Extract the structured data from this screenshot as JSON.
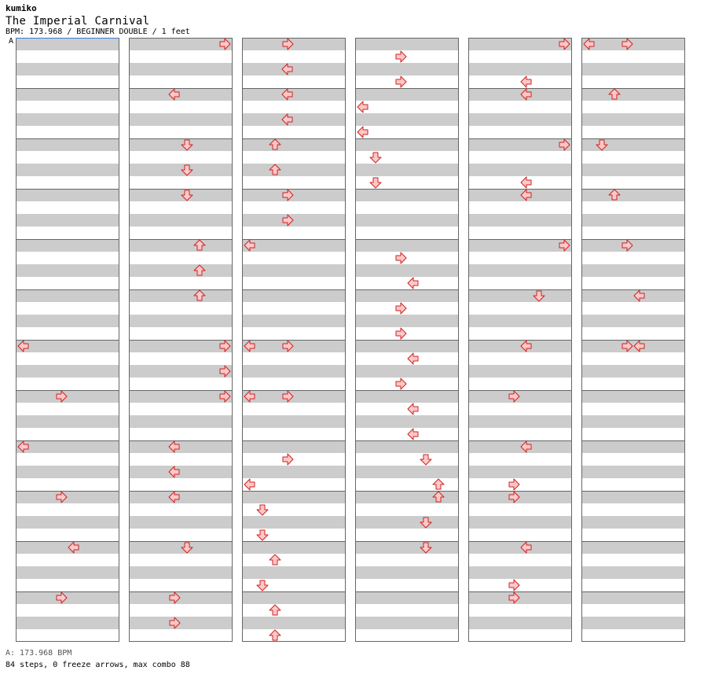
{
  "header": {
    "author": "kumiko",
    "title": "The Imperial Carnival",
    "info": "BPM: 173.968 / BEGINNER DOUBLE / 1 feet"
  },
  "marker": "A",
  "footer": {
    "bpm_line": "A: 173.968 BPM",
    "stats_line": "84 steps, 0 freeze arrows, max combo 88"
  },
  "colors": {
    "band_gray": "#cccccc",
    "border": "#666666",
    "arrow_fill": "#ffc8c8",
    "arrow_stroke": "#cc2222",
    "bpm_line": "#3a7ad8"
  },
  "chart_data": {
    "type": "step-chart",
    "columns": 6,
    "measures_per_column": 12,
    "lane_order": [
      "left",
      "down",
      "up",
      "right",
      "left",
      "down",
      "up",
      "right"
    ],
    "notes": [
      {
        "col": 1,
        "row": 0,
        "lane": 7,
        "dir": "right"
      },
      {
        "col": 1,
        "row": 4,
        "lane": 3,
        "dir": "left"
      },
      {
        "col": 1,
        "row": 8,
        "lane": 4,
        "dir": "down"
      },
      {
        "col": 1,
        "row": 10,
        "lane": 4,
        "dir": "down"
      },
      {
        "col": 1,
        "row": 12,
        "lane": 4,
        "dir": "down"
      },
      {
        "col": 1,
        "row": 16,
        "lane": 5,
        "dir": "up"
      },
      {
        "col": 1,
        "row": 18,
        "lane": 5,
        "dir": "up"
      },
      {
        "col": 1,
        "row": 20,
        "lane": 5,
        "dir": "up"
      },
      {
        "col": 1,
        "row": 24,
        "lane": 7,
        "dir": "right"
      },
      {
        "col": 1,
        "row": 26,
        "lane": 7,
        "dir": "right"
      },
      {
        "col": 1,
        "row": 28,
        "lane": 7,
        "dir": "right"
      },
      {
        "col": 1,
        "row": 32,
        "lane": 3,
        "dir": "left"
      },
      {
        "col": 1,
        "row": 34,
        "lane": 3,
        "dir": "left"
      },
      {
        "col": 1,
        "row": 36,
        "lane": 3,
        "dir": "left"
      },
      {
        "col": 1,
        "row": 40,
        "lane": 4,
        "dir": "down"
      },
      {
        "col": 1,
        "row": 44,
        "lane": 3,
        "dir": "right"
      },
      {
        "col": 1,
        "row": 46,
        "lane": 3,
        "dir": "right"
      },
      {
        "col": 2,
        "row": 0,
        "lane": 3,
        "dir": "right"
      },
      {
        "col": 2,
        "row": 2,
        "lane": 3,
        "dir": "left"
      },
      {
        "col": 2,
        "row": 4,
        "lane": 3,
        "dir": "left"
      },
      {
        "col": 2,
        "row": 6,
        "lane": 3,
        "dir": "left"
      },
      {
        "col": 2,
        "row": 8,
        "lane": 2,
        "dir": "up"
      },
      {
        "col": 2,
        "row": 10,
        "lane": 2,
        "dir": "up"
      },
      {
        "col": 2,
        "row": 12,
        "lane": 3,
        "dir": "right"
      },
      {
        "col": 2,
        "row": 14,
        "lane": 3,
        "dir": "right"
      },
      {
        "col": 2,
        "row": 16,
        "lane": 0,
        "dir": "left"
      },
      {
        "col": 2,
        "row": 24,
        "lane": 0,
        "dir": "left"
      },
      {
        "col": 2,
        "row": 24,
        "lane": 3,
        "dir": "right"
      },
      {
        "col": 2,
        "row": 28,
        "lane": 0,
        "dir": "left"
      },
      {
        "col": 2,
        "row": 28,
        "lane": 3,
        "dir": "right"
      },
      {
        "col": 2,
        "row": 33,
        "lane": 3,
        "dir": "right"
      },
      {
        "col": 2,
        "row": 35,
        "lane": 0,
        "dir": "left"
      },
      {
        "col": 2,
        "row": 37,
        "lane": 1,
        "dir": "down"
      },
      {
        "col": 2,
        "row": 39,
        "lane": 1,
        "dir": "down"
      },
      {
        "col": 2,
        "row": 41,
        "lane": 2,
        "dir": "up"
      },
      {
        "col": 2,
        "row": 43,
        "lane": 1,
        "dir": "down"
      },
      {
        "col": 2,
        "row": 45,
        "lane": 2,
        "dir": "up"
      },
      {
        "col": 2,
        "row": 47,
        "lane": 2,
        "dir": "up"
      },
      {
        "col": 3,
        "row": 1,
        "lane": 3,
        "dir": "right"
      },
      {
        "col": 3,
        "row": 3,
        "lane": 3,
        "dir": "right"
      },
      {
        "col": 3,
        "row": 5,
        "lane": 0,
        "dir": "left"
      },
      {
        "col": 3,
        "row": 7,
        "lane": 0,
        "dir": "left"
      },
      {
        "col": 3,
        "row": 9,
        "lane": 1,
        "dir": "down"
      },
      {
        "col": 3,
        "row": 11,
        "lane": 1,
        "dir": "down"
      },
      {
        "col": 3,
        "row": 17,
        "lane": 3,
        "dir": "right"
      },
      {
        "col": 3,
        "row": 19,
        "lane": 4,
        "dir": "left"
      },
      {
        "col": 3,
        "row": 21,
        "lane": 3,
        "dir": "right"
      },
      {
        "col": 3,
        "row": 23,
        "lane": 3,
        "dir": "right"
      },
      {
        "col": 3,
        "row": 25,
        "lane": 4,
        "dir": "left"
      },
      {
        "col": 3,
        "row": 27,
        "lane": 3,
        "dir": "right"
      },
      {
        "col": 3,
        "row": 29,
        "lane": 4,
        "dir": "left"
      },
      {
        "col": 3,
        "row": 31,
        "lane": 4,
        "dir": "left"
      },
      {
        "col": 3,
        "row": 33,
        "lane": 5,
        "dir": "down"
      },
      {
        "col": 3,
        "row": 35,
        "lane": 6,
        "dir": "up"
      },
      {
        "col": 3,
        "row": 36,
        "lane": 6,
        "dir": "up"
      },
      {
        "col": 3,
        "row": 38,
        "lane": 5,
        "dir": "down"
      },
      {
        "col": 3,
        "row": 40,
        "lane": 5,
        "dir": "down"
      },
      {
        "col": 4,
        "row": 0,
        "lane": 7,
        "dir": "right"
      },
      {
        "col": 4,
        "row": 3,
        "lane": 4,
        "dir": "left"
      },
      {
        "col": 4,
        "row": 4,
        "lane": 4,
        "dir": "left"
      },
      {
        "col": 4,
        "row": 8,
        "lane": 7,
        "dir": "right"
      },
      {
        "col": 4,
        "row": 11,
        "lane": 4,
        "dir": "left"
      },
      {
        "col": 4,
        "row": 12,
        "lane": 4,
        "dir": "left"
      },
      {
        "col": 4,
        "row": 16,
        "lane": 7,
        "dir": "right"
      },
      {
        "col": 4,
        "row": 20,
        "lane": 5,
        "dir": "down"
      },
      {
        "col": 4,
        "row": 24,
        "lane": 4,
        "dir": "left"
      },
      {
        "col": 4,
        "row": 28,
        "lane": 3,
        "dir": "right"
      },
      {
        "col": 4,
        "row": 32,
        "lane": 4,
        "dir": "left"
      },
      {
        "col": 4,
        "row": 35,
        "lane": 3,
        "dir": "right"
      },
      {
        "col": 4,
        "row": 36,
        "lane": 3,
        "dir": "right"
      },
      {
        "col": 4,
        "row": 40,
        "lane": 4,
        "dir": "left"
      },
      {
        "col": 4,
        "row": 43,
        "lane": 3,
        "dir": "right"
      },
      {
        "col": 4,
        "row": 44,
        "lane": 3,
        "dir": "right"
      },
      {
        "col": 5,
        "row": 0,
        "lane": 0,
        "dir": "left"
      },
      {
        "col": 5,
        "row": 0,
        "lane": 3,
        "dir": "right"
      },
      {
        "col": 5,
        "row": 4,
        "lane": 2,
        "dir": "up"
      },
      {
        "col": 5,
        "row": 8,
        "lane": 1,
        "dir": "down"
      },
      {
        "col": 5,
        "row": 12,
        "lane": 2,
        "dir": "up"
      },
      {
        "col": 5,
        "row": 16,
        "lane": 3,
        "dir": "right"
      },
      {
        "col": 5,
        "row": 20,
        "lane": 4,
        "dir": "left"
      },
      {
        "col": 5,
        "row": 24,
        "lane": 3,
        "dir": "right"
      },
      {
        "col": 5,
        "row": 24,
        "lane": 4,
        "dir": "left"
      },
      {
        "col": 0,
        "row": 24,
        "lane": 0,
        "dir": "left"
      },
      {
        "col": 0,
        "row": 28,
        "lane": 3,
        "dir": "right"
      },
      {
        "col": 0,
        "row": 32,
        "lane": 0,
        "dir": "left"
      },
      {
        "col": 0,
        "row": 36,
        "lane": 3,
        "dir": "right"
      },
      {
        "col": 0,
        "row": 40,
        "lane": 4,
        "dir": "left"
      },
      {
        "col": 0,
        "row": 44,
        "lane": 3,
        "dir": "right"
      }
    ]
  }
}
